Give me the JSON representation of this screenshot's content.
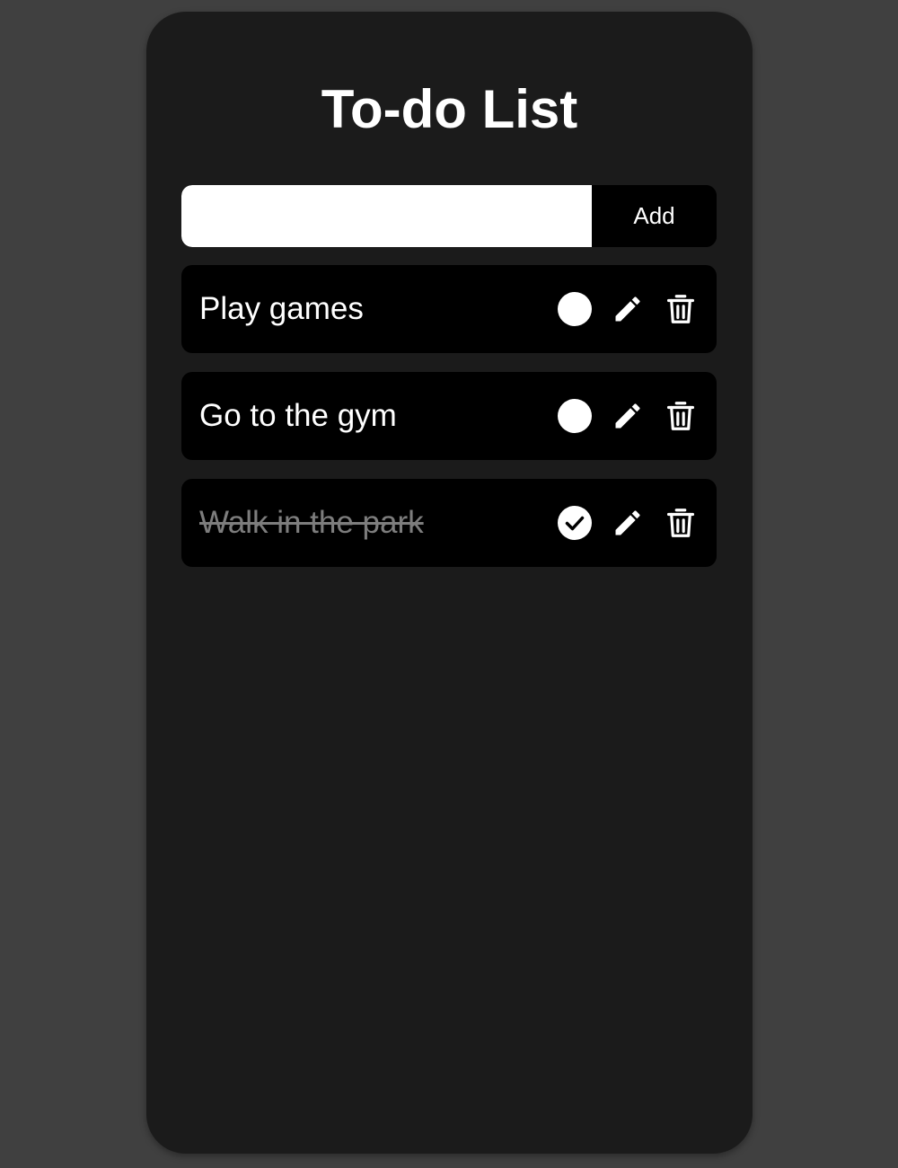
{
  "app": {
    "title": "To-do List"
  },
  "form": {
    "input_value": "",
    "input_placeholder": "",
    "add_label": "Add"
  },
  "todos": [
    {
      "text": "Play games",
      "completed": false
    },
    {
      "text": "Go to the gym",
      "completed": false
    },
    {
      "text": "Walk in the park",
      "completed": true
    }
  ],
  "icons": {
    "toggle_incomplete": "circle-icon",
    "toggle_complete": "check-circle-icon",
    "edit": "pencil-icon",
    "delete": "trash-icon"
  },
  "colors": {
    "page_bg": "#404040",
    "card_bg": "#1b1b1b",
    "item_bg": "#000000",
    "text": "#ffffff",
    "done_text": "#7d7d7d"
  }
}
